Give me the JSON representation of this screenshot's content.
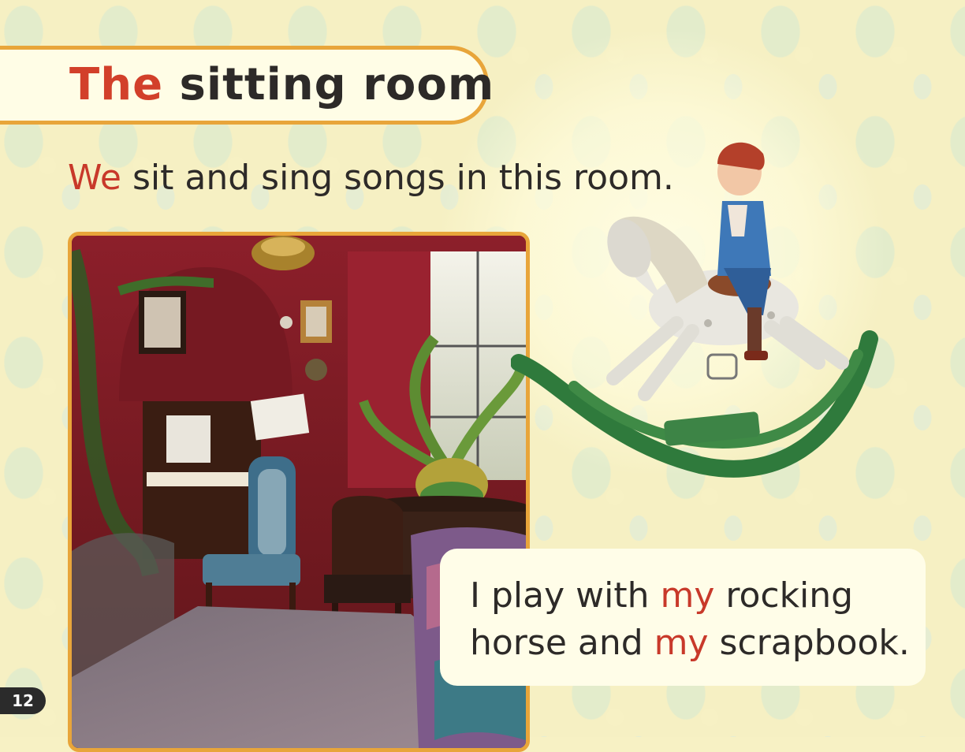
{
  "title": {
    "accent": "The",
    "rest": "sitting room"
  },
  "sentence1": {
    "accent": "We",
    "rest": "sit and sing songs in this room."
  },
  "caption": {
    "part1": "I play with ",
    "accent1": "my",
    "part2": " rocking horse and ",
    "accent2": "my",
    "part3": " scrapbook."
  },
  "page_number": "12",
  "colors": {
    "accent_red": "#d2402a",
    "frame_orange": "#e8a53a",
    "background": "#f6f0c3",
    "text": "#2d2a28"
  },
  "images": {
    "photo": "victorian-sitting-room-photo",
    "illustration": "boy-on-rocking-horse-illustration"
  }
}
